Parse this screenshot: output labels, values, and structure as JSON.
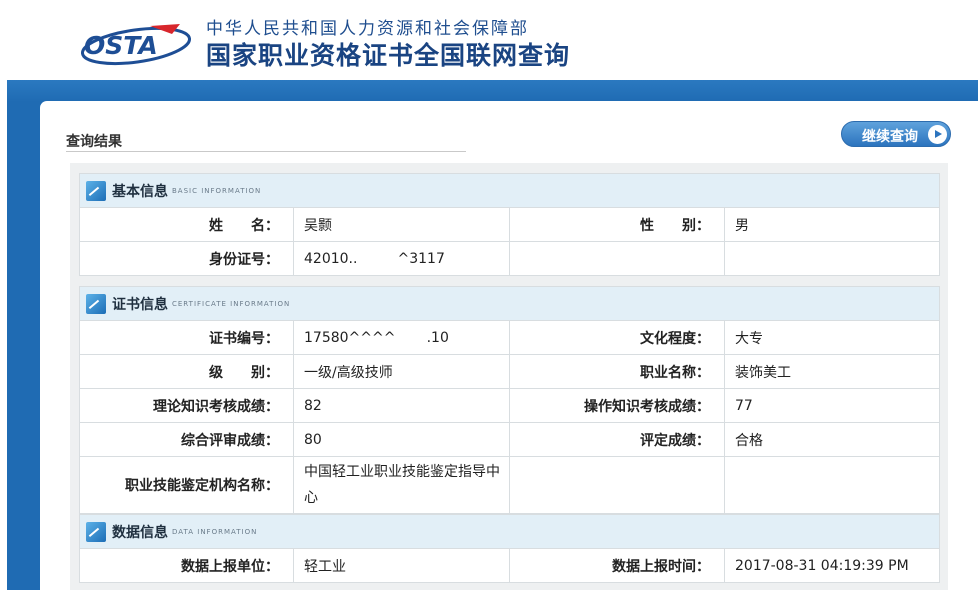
{
  "header": {
    "logo_text": "OSTA",
    "ministry": "中华人民共和国人力资源和社会保障部",
    "title": "国家职业资格证书全国联网查询"
  },
  "result": {
    "title": "查询结果",
    "continue_button": "继续查询"
  },
  "basic": {
    "title": "基本信息",
    "subtitle": "Basic Information",
    "name_label": "姓　　名：",
    "name_value": "吴颢",
    "gender_label": "性　　别：",
    "gender_value": "男",
    "id_label": "身份证号：",
    "id_value": "42010..         ^3117"
  },
  "certificate": {
    "title": "证书信息",
    "subtitle": "Certificate Information",
    "cert_no_label": "证书编号：",
    "cert_no_value": "17580^^^^       .10",
    "education_label": "文化程度：",
    "education_value": "大专",
    "level_label": "级　　别：",
    "level_value": "一级/高级技师",
    "occupation_label": "职业名称：",
    "occupation_value": "装饰美工",
    "theory_label": "理论知识考核成绩：",
    "theory_value": "82",
    "operation_label": "操作知识考核成绩：",
    "operation_value": "77",
    "overall_label": "综合评审成绩：",
    "overall_value": "80",
    "rating_label": "评定成绩：",
    "rating_value": "合格",
    "agency_label": "职业技能鉴定机构名称：",
    "agency_value": "中国轻工业职业技能鉴定指导中心"
  },
  "data_info": {
    "title": "数据信息",
    "subtitle": "Data Information",
    "unit_label": "数据上报单位：",
    "unit_value": "轻工业",
    "time_label": "数据上报时间：",
    "time_value": "2017-08-31 04:19:39 PM"
  },
  "colors": {
    "brand_blue": "#1f6bb3",
    "section_bg": "#e2eff7",
    "label_color": "#1f3f62"
  }
}
